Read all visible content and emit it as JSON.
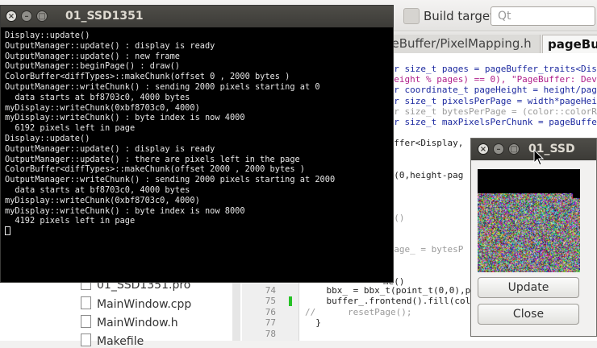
{
  "ide": {
    "build_target_label": "Build target:",
    "build_target_value": "Qt",
    "tabs": [
      "geBuffer/PixelMapping.h",
      "pageBuf"
    ],
    "code_lines": [
      {
        "t": "xpr size_t pages = pageBuffer_traits<Dis",
        "c": "#1d2aa0"
      },
      {
        "t": "(height % pages) == 0), \"PageBuffer: Devi",
        "c": "#b0208a"
      },
      {
        "t": "xpr coordinate_t pageHeight = height/page",
        "c": "#1d2aa0"
      },
      {
        "t": "xpr size_t pixelsPerPage = width*pageHei",
        "c": "#1d2aa0"
      },
      {
        "t": "xpr size_t bytesPerPage = (color::colorRe",
        "c": "#9a9a9a"
      },
      {
        "t": "xpr size_t maxPixelsPerChunk = pageBuffe",
        "c": "#1d2aa0"
      },
      {
        "t": "",
        "c": "#000"
      },
      {
        "t": "Buffer<Display,",
        "c": "#222"
      },
      {
        "t": "",
        "c": "#000"
      },
      {
        "t": "",
        "c": "#000"
      },
      {
        "t": "_t(0,height-pag",
        "c": "#222"
      },
      {
        "t": "",
        "c": "#000"
      },
      {
        "t": "",
        "c": "#000"
      },
      {
        "t": "",
        "c": "#000"
      },
      {
        "t": "ge()",
        "c": "#9a9a9a"
      },
      {
        "t": "",
        "c": "#000"
      },
      {
        "t": "",
        "c": "#000"
      },
      {
        "t": "nPage_ = bytesP",
        "c": "#9a9a9a"
      },
      {
        "t": "",
        "c": "#000"
      },
      {
        "t": "",
        "c": "#000"
      },
      {
        "t": "me()",
        "c": "#222"
      }
    ],
    "bottom_lines": [
      {
        "n": "74",
        "t": "    bbx_ = bbx_t(point_t(0,0),p"
      },
      {
        "n": "75",
        "t": "    buffer_.frontend().fill(col"
      },
      {
        "n": "76",
        "t": "//      resetPage();"
      },
      {
        "n": "77",
        "t": "  }"
      },
      {
        "n": "78",
        "t": ""
      }
    ],
    "tree_items": [
      "01_SSD1351.pro",
      "MainWindow.cpp",
      "MainWindow.h",
      "Makefile"
    ]
  },
  "terminal": {
    "title": "01_SSD1351",
    "lines": [
      "Display::update()",
      "OutputManager::update() : display is ready",
      "OutputManager::update() : new frame",
      "OutputManager::beginPage() : draw()",
      "ColorBuffer<diffTypes>::makeChunk(offset 0 , 2000 bytes )",
      "OutputManager::writeChunk() : sending 2000 pixels starting at 0",
      "  data starts at bf8703c0, 4000 bytes",
      "myDisplay::writeChunk(0xbf8703c0, 4000)",
      "myDisplay::writeChunk() : byte index is now 4000",
      "  6192 pixels left in page",
      "Display::update()",
      "OutputManager::update() : display is ready",
      "OutputManager::update() : there are pixels left in the page",
      "ColorBuffer<diffTypes>::makeChunk(offset 2000 , 2000 bytes )",
      "OutputManager::writeChunk() : sending 2000 pixels starting at 2000",
      "  data starts at bf8703c0, 4000 bytes",
      "myDisplay::writeChunk(0xbf8703c0, 4000)",
      "myDisplay::writeChunk() : byte index is now 8000",
      "  4192 pixels left in page"
    ]
  },
  "app": {
    "title": "01_SSD",
    "update_label": "Update",
    "close_label": "Close"
  },
  "colors": {
    "title_bar": "#3c3b37",
    "terminal_bg": "#000000",
    "terminal_fg": "#e6e6e6",
    "window_bg": "#f2f1f0",
    "keyword": "#1d2aa0",
    "string": "#b0208a",
    "comment": "#9a9a9a"
  }
}
